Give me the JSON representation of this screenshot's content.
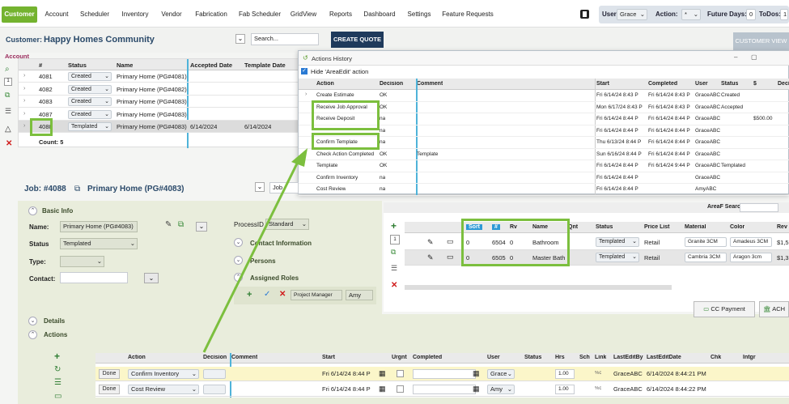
{
  "nav": {
    "tabs": [
      "Customer",
      "Account",
      "Scheduler",
      "Inventory",
      "Vendor",
      "Fabrication",
      "Fab Scheduler",
      "GridView",
      "Reports",
      "Dashboard",
      "Settings",
      "Feature Requests"
    ],
    "user_label": "User:",
    "user_value": "Grace",
    "action_label": "Action:",
    "action_value": "*",
    "future_label": "Future Days:",
    "future_value": "0",
    "todos_label": "ToDos:",
    "todos_value": "1"
  },
  "customer": {
    "label": "Customer:",
    "name": "Happy Homes Community",
    "search_placeholder": "Search...",
    "create_quote": "CREATE QUOTE",
    "customer_view": "CUSTOMER VIEW",
    "account_tab": "Account"
  },
  "acct_grid": {
    "headers": [
      "#",
      "Status",
      "Name",
      "Accepted Date",
      "Template Date"
    ],
    "rows": [
      [
        "4081",
        "Created",
        "Primary Home (PG#4081)",
        "",
        ""
      ],
      [
        "4082",
        "Created",
        "Primary Home (PG#4082)",
        "",
        ""
      ],
      [
        "4083",
        "Created",
        "Primary Home (PG#4083)",
        "",
        ""
      ],
      [
        "4087",
        "Created",
        "Primary Home (PG#4083)",
        "",
        ""
      ],
      [
        "4088",
        "Templated",
        "Primary Home (PG#4083)",
        "6/14/2024",
        "6/14/2024"
      ]
    ],
    "count": "Count: 5"
  },
  "history": {
    "title": "Actions History",
    "hide_label": "Hide 'AreaEdit' action",
    "headers": [
      "Action",
      "Decision",
      "Comment",
      "Start",
      "Completed",
      "User",
      "Status",
      "$",
      "Deci"
    ],
    "rows": [
      [
        "Create Estimate",
        "OK",
        "",
        "Fri 6/14/24 8:43 P",
        "Fri 6/14/24 8:43 P",
        "GraceABC",
        "Created",
        "",
        ""
      ],
      [
        "Receive Job Approval",
        "OK",
        "",
        "Mon 6/17/24 8:43 P",
        "Fri 6/14/24 8:43 P",
        "GraceABC",
        "Accepted",
        "",
        ""
      ],
      [
        "Receive Deposit",
        "na",
        "",
        "Fri 6/14/24 8:44 P",
        "Fri 6/14/24 8:44 P",
        "GraceABC",
        "",
        "$500.00",
        ""
      ],
      [
        "",
        "na",
        "",
        "Fri 6/14/24 8:44 P",
        "Fri 6/14/24 8:44 P",
        "GraceABC",
        "",
        "",
        ""
      ],
      [
        "Confirm Template",
        "na",
        "",
        "Thu 6/13/24 8:44 P",
        "Fri 6/14/24 8:44 P",
        "GraceABC",
        "",
        "",
        ""
      ],
      [
        "Check Action Completed",
        "OK",
        "Template",
        "Sun 6/16/24 8:44 P",
        "Fri 6/14/24 8:44 P",
        "GraceABC",
        "",
        "",
        ""
      ],
      [
        "Template",
        "OK",
        "",
        "Fri 6/14/24 8:44 P",
        "Fri 6/14/24 9:44 P",
        "GraceABC",
        "Templated",
        "",
        ""
      ],
      [
        "Confirm Inventory",
        "na",
        "",
        "Fri 6/14/24 8:44 P",
        "",
        "GraceABC",
        "",
        "",
        ""
      ],
      [
        "Cost Review",
        "na",
        "",
        "Fri 6/14/24 8:44 P",
        "",
        "AmyABC",
        "",
        "",
        ""
      ]
    ]
  },
  "job": {
    "title": "Job: #4088",
    "name": "Primary Home (PG#4083)",
    "search": "Job Search",
    "basic_info": "Basic Info",
    "name_label": "Name:",
    "name_value": "Primary Home (PG#4083)",
    "status_label": "Status",
    "status_value": "Templated",
    "type_label": "Type:",
    "contact_label": "Contact:",
    "process_label": "ProcessID",
    "process_value": "Standard",
    "contact_info": "Contact Information",
    "persons": "Persons",
    "assigned_roles": "Assigned Roles",
    "role_value": "Project Manager",
    "role_user": "Amy",
    "details": "Details",
    "actions": "Actions",
    "area_search": "AreaF Search:"
  },
  "areas": {
    "headers": [
      "Sort",
      "#",
      "Rv",
      "Name",
      "Qnt",
      "Status",
      "Price List",
      "Material",
      "Color",
      "Rev"
    ],
    "rows": [
      [
        "0",
        "6504",
        "0",
        "Bathroom",
        "",
        "Templated",
        "Retail",
        "Granite 3CM",
        "Amadeus 3CM",
        "$1,5"
      ],
      [
        "0",
        "6505",
        "0",
        "Master Bath",
        "",
        "Templated",
        "Retail",
        "Cambria 3CM",
        "Aragon 3cm",
        "$1,3"
      ]
    ],
    "cc_payment": "CC Payment",
    "ach": "ACH"
  },
  "actions": {
    "headers": [
      "Action",
      "Decision",
      "Comment",
      "Start",
      "Urgnt",
      "Completed",
      "User",
      "Status",
      "Hrs",
      "Sch",
      "Link",
      "LastEditBy",
      "LastEditDate",
      "Chk",
      "Intgr"
    ],
    "rows": [
      [
        "Done",
        "Confirm Inventory",
        "",
        "Fri 6/14/24 8:44 P",
        "",
        "",
        "Grace",
        "",
        "1.00",
        "",
        "%c",
        "GraceABC",
        "6/14/2024 8:44:21 PM",
        ""
      ],
      [
        "Done",
        "Cost Review",
        "",
        "Fri 6/14/24 8:44 P",
        "",
        "",
        "Amy",
        "",
        "1.00",
        "",
        "%c",
        "GraceABC",
        "6/14/2024 8:44:22 PM",
        ""
      ]
    ]
  }
}
